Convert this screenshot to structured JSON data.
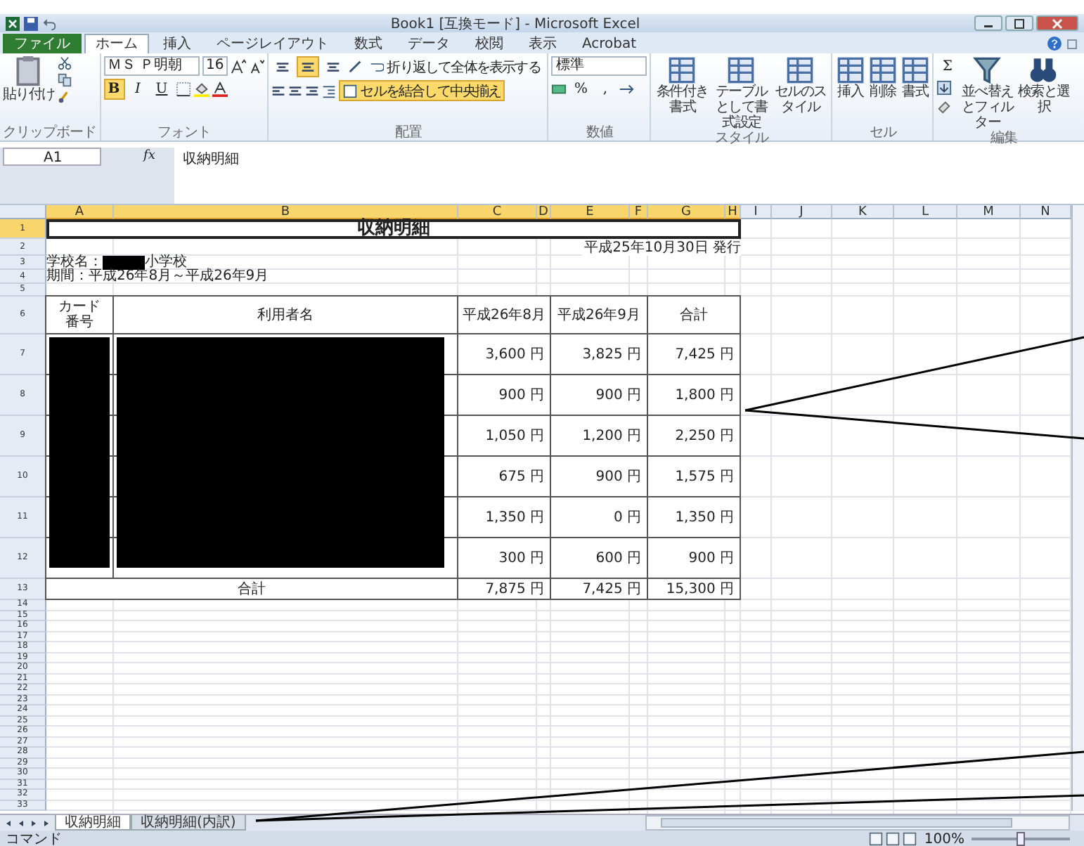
{
  "window": {
    "title": "Book1 [互換モード] - Microsoft Excel"
  },
  "tabs": [
    {
      "label": "ファイル",
      "kind": "file",
      "selected": false
    },
    {
      "label": "ホーム",
      "kind": "tab",
      "selected": true
    },
    {
      "label": "挿入",
      "kind": "tab",
      "selected": false
    },
    {
      "label": "ページレイアウト",
      "kind": "tab",
      "selected": false
    },
    {
      "label": "数式",
      "kind": "tab",
      "selected": false
    },
    {
      "label": "データ",
      "kind": "tab",
      "selected": false
    },
    {
      "label": "校閲",
      "kind": "tab",
      "selected": false
    },
    {
      "label": "表示",
      "kind": "tab",
      "selected": false
    },
    {
      "label": "Acrobat",
      "kind": "tab",
      "selected": false
    }
  ],
  "ribbon": {
    "clipboard": {
      "label": "クリップボード",
      "paste": "貼り付け"
    },
    "font": {
      "label": "フォント",
      "font_name": "ＭＳ Ｐ明朝",
      "font_size": "16",
      "styles": [
        {
          "label": "B",
          "selected": true
        },
        {
          "label": "I",
          "selected": false
        },
        {
          "label": "U",
          "selected": false
        }
      ]
    },
    "alignment": {
      "label": "配置",
      "align_buttons": [
        {
          "selected": false
        },
        {
          "selected": true
        },
        {
          "selected": false
        }
      ],
      "wrap": "折り返して全体を表示する",
      "merge": "セルを結合して中央揃え",
      "merge_selected": true
    },
    "number": {
      "label": "数値",
      "format": "標準",
      "symbols": [
        "%",
        ","
      ]
    },
    "styles": {
      "label": "スタイル",
      "buttons": [
        "条件付き書式",
        "テーブルとして書式設定",
        "セルのスタイル"
      ]
    },
    "cells": {
      "label": "セル",
      "buttons": [
        "挿入",
        "削除",
        "書式"
      ]
    },
    "editing": {
      "label": "編集",
      "sum": "Σ",
      "buttons": [
        "並べ替えとフィルター",
        "検索と選択"
      ]
    }
  },
  "formula_bar": {
    "name_box": "A1",
    "fx": "fx",
    "formula": "収納明細"
  },
  "sheet": {
    "columns": [
      {
        "label": "A",
        "selected": true
      },
      {
        "label": "B",
        "selected": true
      },
      {
        "label": "C",
        "selected": true
      },
      {
        "label": "D",
        "selected": true
      },
      {
        "label": "E",
        "selected": true
      },
      {
        "label": "F",
        "selected": true
      },
      {
        "label": "G",
        "selected": true
      },
      {
        "label": "H",
        "selected": true
      },
      {
        "label": "I",
        "selected": false
      },
      {
        "label": "J",
        "selected": false
      },
      {
        "label": "K",
        "selected": false
      },
      {
        "label": "L",
        "selected": false
      },
      {
        "label": "M",
        "selected": false
      },
      {
        "label": "N",
        "selected": false
      }
    ],
    "rows": [
      {
        "number": "1",
        "selected": true
      },
      {
        "number": "2",
        "selected": false
      },
      {
        "number": "3",
        "selected": false
      },
      {
        "number": "4",
        "selected": false
      },
      {
        "number": "5",
        "selected": false
      },
      {
        "number": "6",
        "selected": false
      },
      {
        "number": "7",
        "selected": false
      },
      {
        "number": "8",
        "selected": false
      },
      {
        "number": "9",
        "selected": false
      },
      {
        "number": "10",
        "selected": false
      },
      {
        "number": "11",
        "selected": false
      },
      {
        "number": "12",
        "selected": false
      },
      {
        "number": "13",
        "selected": false
      },
      {
        "number": "14",
        "selected": false
      },
      {
        "number": "15",
        "selected": false
      },
      {
        "number": "16",
        "selected": false
      },
      {
        "number": "17",
        "selected": false
      },
      {
        "number": "18",
        "selected": false
      },
      {
        "number": "19",
        "selected": false
      },
      {
        "number": "20",
        "selected": false
      },
      {
        "number": "21",
        "selected": false
      },
      {
        "number": "22",
        "selected": false
      },
      {
        "number": "23",
        "selected": false
      },
      {
        "number": "24",
        "selected": false
      },
      {
        "number": "25",
        "selected": false
      },
      {
        "number": "26",
        "selected": false
      },
      {
        "number": "27",
        "selected": false
      },
      {
        "number": "28",
        "selected": false
      },
      {
        "number": "29",
        "selected": false
      },
      {
        "number": "30",
        "selected": false
      },
      {
        "number": "31",
        "selected": false
      },
      {
        "number": "32",
        "selected": false
      },
      {
        "number": "33",
        "selected": false
      }
    ],
    "title": "収納明細",
    "issued": "平成25年10月30日 発行",
    "school_label": "学校名：",
    "school_suffix": "小学校",
    "period": "期間：平成26年8月～平成26年9月",
    "table": {
      "columns": [
        "カード番号",
        "利用者名",
        "平成26年8月",
        "平成26年9月",
        "合計"
      ],
      "rows": [
        [
          "",
          "",
          "3,600 円",
          "3,825 円",
          "7,425 円"
        ],
        [
          "",
          "",
          "900 円",
          "900 円",
          "1,800 円"
        ],
        [
          "",
          "",
          "1,050 円",
          "1,200 円",
          "2,250 円"
        ],
        [
          "",
          "",
          "675 円",
          "900 円",
          "1,575 円"
        ],
        [
          "",
          "",
          "1,350 円",
          "0 円",
          "1,350 円"
        ],
        [
          "",
          "",
          "300 円",
          "600 円",
          "900 円"
        ]
      ],
      "total": {
        "label": "合計",
        "values": [
          "7,875 円",
          "7,425 円",
          "15,300 円"
        ]
      }
    }
  },
  "sheet_tabs": [
    {
      "label": "収納明細",
      "selected": true
    },
    {
      "label": "収納明細(内訳)",
      "selected": false
    }
  ],
  "status_bar": {
    "mode": "コマンド",
    "zoom": "100%",
    "level": 0.5
  }
}
